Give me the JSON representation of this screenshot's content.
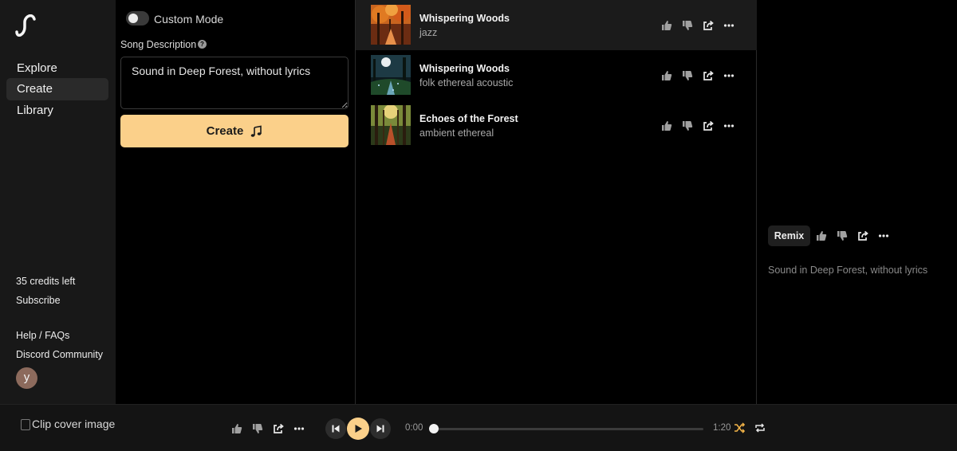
{
  "brand": {
    "logo_icon": "suno-wave-logo"
  },
  "sidebar": {
    "nav": [
      {
        "label": "Explore",
        "active": false
      },
      {
        "label": "Create",
        "active": true
      },
      {
        "label": "Library",
        "active": false
      }
    ],
    "credits": "35 credits left",
    "subscribe": "Subscribe",
    "help": "Help / FAQs",
    "discord": "Discord Community",
    "avatar_letter": "y"
  },
  "create": {
    "mode_toggle_label": "Custom Mode",
    "mode_toggle_on": false,
    "description_label": "Song Description",
    "help_glyph": "?",
    "description_value": "Sound in Deep Forest, without lyrics",
    "create_button": "Create",
    "create_icon": "music-note-icon",
    "accent_color": "#fbd08a"
  },
  "songs": [
    {
      "title": "Whispering Woods",
      "tags": "jazz",
      "active": true,
      "cover": "autumn-forest"
    },
    {
      "title": "Whispering Woods",
      "tags": "folk ethereal acoustic",
      "active": false,
      "cover": "moonlit-forest"
    },
    {
      "title": "Echoes of the Forest",
      "tags": "ambient ethereal",
      "active": false,
      "cover": "forest-path"
    }
  ],
  "detail": {
    "remix_label": "Remix",
    "description": "Sound in Deep Forest, without lyrics"
  },
  "player": {
    "cover_alt": "Clip cover image",
    "current_time": "0:00",
    "duration": "1:20",
    "progress": 0.0
  }
}
